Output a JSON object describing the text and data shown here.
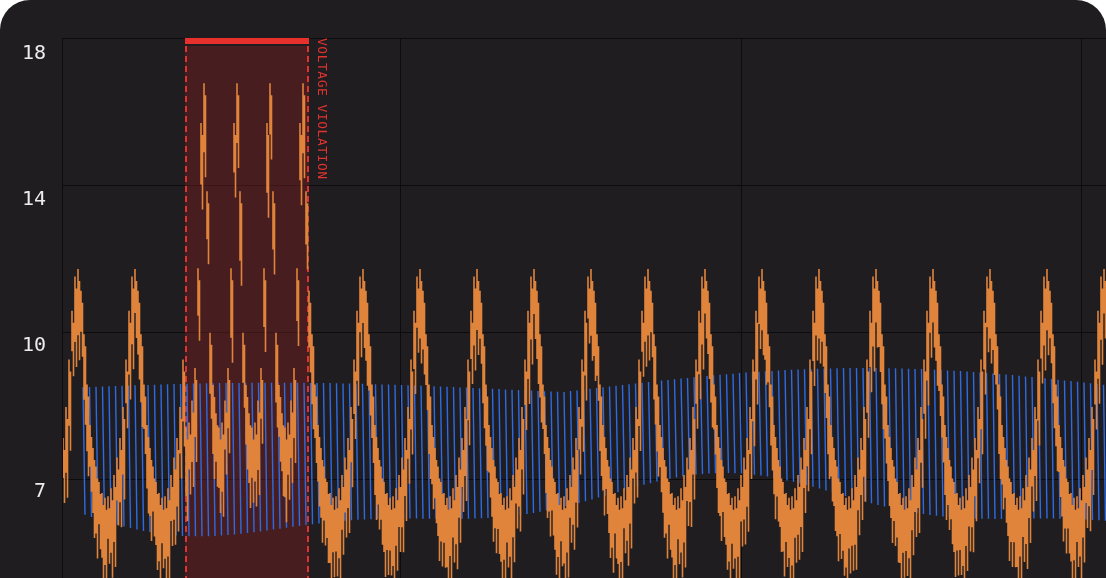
{
  "chart": {
    "y_axis_labels": [
      "18",
      "14",
      "10",
      "7"
    ],
    "annotation": {
      "label": "VOLTAGE VIOLATION"
    },
    "waveforms": [
      {
        "kind": "spiky",
        "color": "#e0843c"
      },
      {
        "kind": "envelope",
        "color": "#2d6be4"
      }
    ]
  }
}
